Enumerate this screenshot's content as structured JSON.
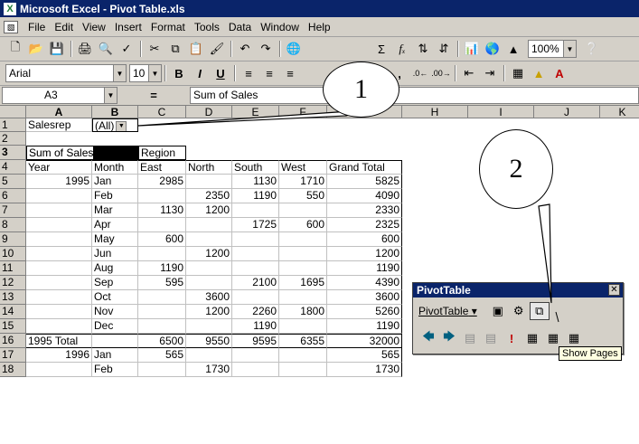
{
  "window": {
    "title": "Microsoft Excel - Pivot Table.xls",
    "app_icon": "excel-icon"
  },
  "menubar": {
    "items": [
      "File",
      "Edit",
      "View",
      "Insert",
      "Format",
      "Tools",
      "Data",
      "Window",
      "Help"
    ]
  },
  "toolbar": {
    "zoom": "100%"
  },
  "format_toolbar": {
    "font": "Arial",
    "size": "10",
    "bold": "B",
    "italic": "I",
    "underline": "U"
  },
  "formula_bar": {
    "name_box": "A3",
    "equals": "=",
    "content": "Sum of Sales"
  },
  "columns": [
    "A",
    "B",
    "C",
    "D",
    "E",
    "F",
    "G",
    "H",
    "I",
    "J",
    "K"
  ],
  "rows": [
    "1",
    "2",
    "3",
    "4",
    "5",
    "6",
    "7",
    "8",
    "9",
    "10",
    "11",
    "12",
    "13",
    "14",
    "15",
    "16",
    "17",
    "18"
  ],
  "sheet": {
    "page_field": {
      "label": "Salesrep",
      "value": "(All)"
    },
    "data_field": "Sum of Sales",
    "column_field": "Region",
    "headers": [
      "Year",
      "Month",
      "East",
      "North",
      "South",
      "West",
      "Grand Total"
    ],
    "data_rows": [
      [
        "1995",
        "Jan",
        "2985",
        "",
        "1130",
        "1710",
        "5825"
      ],
      [
        "",
        "Feb",
        "",
        "2350",
        "1190",
        "550",
        "4090"
      ],
      [
        "",
        "Mar",
        "1130",
        "1200",
        "",
        "",
        "2330"
      ],
      [
        "",
        "Apr",
        "",
        "",
        "1725",
        "600",
        "2325"
      ],
      [
        "",
        "May",
        "600",
        "",
        "",
        "",
        "600"
      ],
      [
        "",
        "Jun",
        "",
        "1200",
        "",
        "",
        "1200"
      ],
      [
        "",
        "Aug",
        "1190",
        "",
        "",
        "",
        "1190"
      ],
      [
        "",
        "Sep",
        "595",
        "",
        "2100",
        "1695",
        "4390"
      ],
      [
        "",
        "Oct",
        "",
        "3600",
        "",
        "",
        "3600"
      ],
      [
        "",
        "Nov",
        "",
        "1200",
        "2260",
        "1800",
        "5260"
      ],
      [
        "",
        "Dec",
        "",
        "",
        "1190",
        "",
        "1190"
      ],
      [
        "1995 Total",
        "",
        "6500",
        "9550",
        "9595",
        "6355",
        "32000"
      ],
      [
        "1996",
        "Jan",
        "565",
        "",
        "",
        "",
        "565"
      ],
      [
        "",
        "Feb",
        "",
        "1730",
        "",
        "",
        "1730"
      ]
    ]
  },
  "pivot_toolbar": {
    "title": "PivotTable",
    "menu_label": "PivotTable",
    "tooltip": "Show Pages"
  },
  "callouts": [
    "1",
    "2"
  ]
}
